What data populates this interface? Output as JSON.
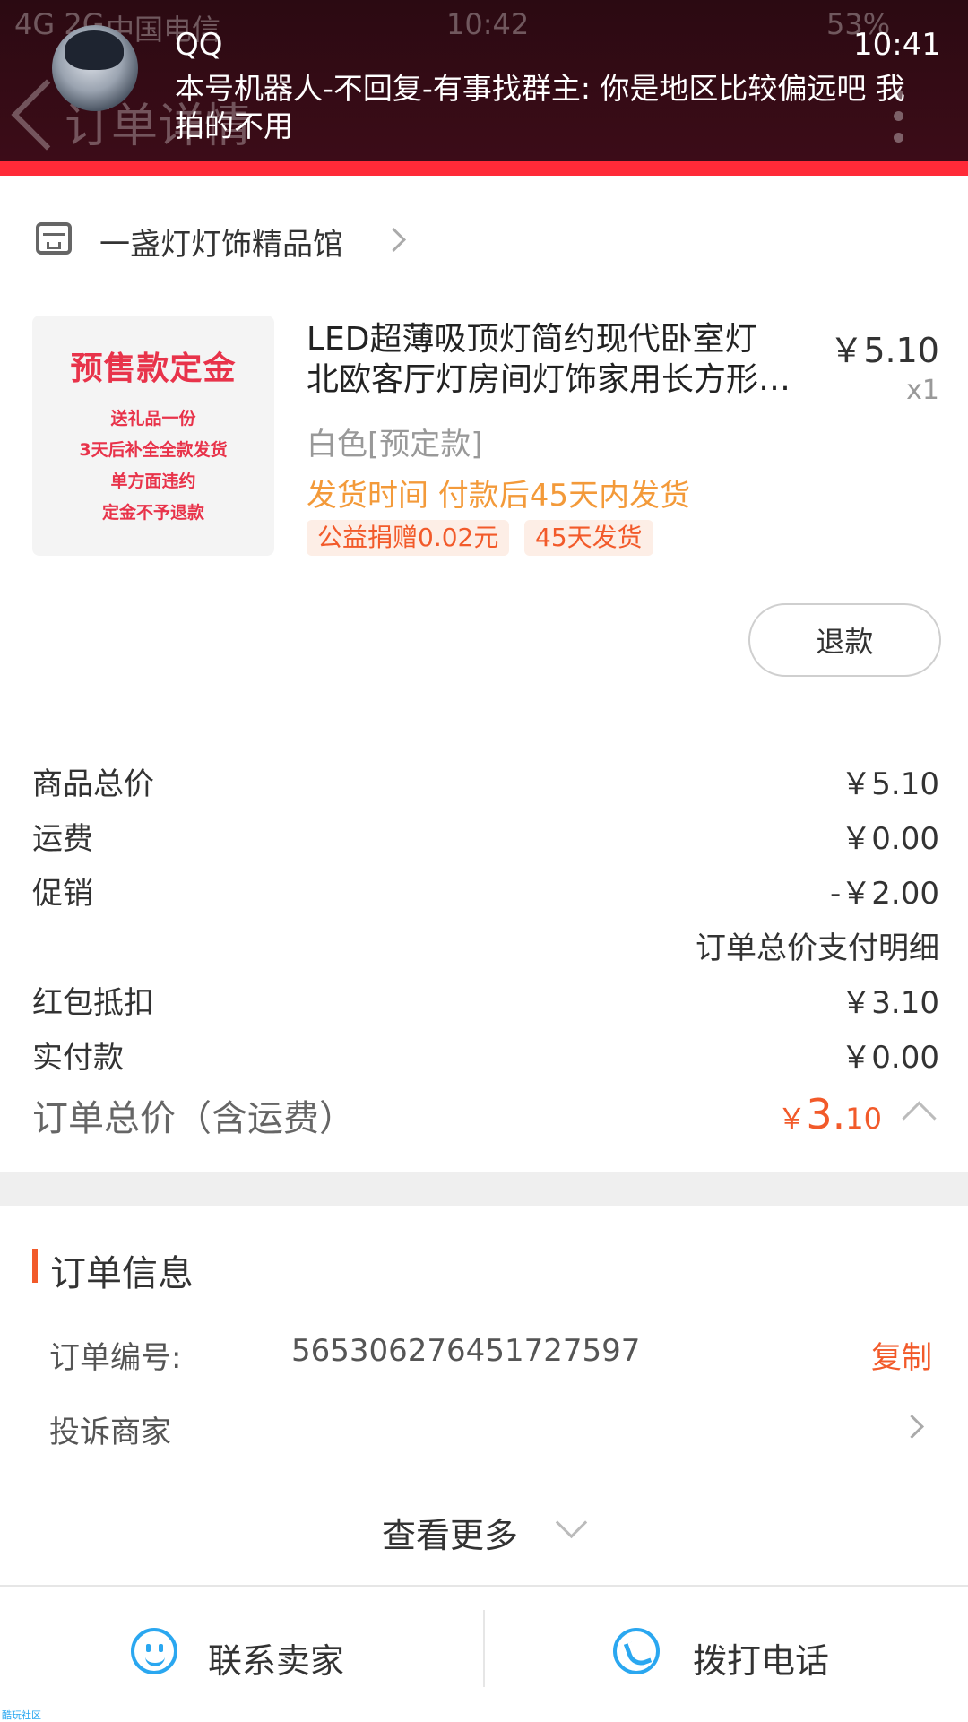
{
  "status_bar": {
    "network": "4G 2G",
    "carrier": "中国电信",
    "time": "10:42",
    "battery": "53%"
  },
  "page": {
    "title": "订单详情"
  },
  "notification": {
    "app": "QQ",
    "time": "10:41",
    "message": "本号机器人-不回复-有事找群主: 你是地区比较偏远吧 我拍的不用"
  },
  "shop": {
    "name": "一盏灯灯饰精品馆"
  },
  "product": {
    "thumbnail": {
      "title": "预售款定金",
      "lines": [
        "送礼品一份",
        "3天后补全全款发货",
        "单方面违约",
        "定金不予退款"
      ]
    },
    "title_line1": "LED超薄吸顶灯简约现代卧室灯",
    "title_line2": "北欧客厅灯房间灯饰家用长方形…",
    "price": "￥5.10",
    "quantity": "x1",
    "sku": "白色[预定款]",
    "shipping": "发货时间 付款后45天内发货",
    "tags": [
      "公益捐赠0.02元",
      "45天发货"
    ],
    "refund_label": "退款"
  },
  "pricing": {
    "rows": [
      {
        "label": "商品总价",
        "value": "￥5.10"
      },
      {
        "label": "运费",
        "value": "￥0.00"
      },
      {
        "label": "促销",
        "value": "-￥2.00"
      },
      {
        "label": "",
        "value": "订单总价支付明细"
      },
      {
        "label": "红包抵扣",
        "value": "￥3.10"
      },
      {
        "label": "实付款",
        "value": "￥0.00"
      }
    ],
    "total_label": "订单总价（含运费）",
    "total_currency": "￥",
    "total_int": "3.",
    "total_dec": "10"
  },
  "order_info": {
    "section_title": "订单信息",
    "number_label": "订单编号:",
    "number_value": "565306276451727597",
    "copy_label": "复制",
    "complain_label": "投诉商家",
    "more_label": "查看更多"
  },
  "bottom_bar": {
    "contact_label": "联系卖家",
    "call_label": "拨打电话"
  },
  "watermark": "酷玩社区",
  "colors": {
    "accent": "#f25a2a",
    "header": "#3c0c18",
    "header_line": "#ff2a38",
    "icon_blue": "#2aa7f0",
    "ship_orange": "#f39a3a"
  },
  "icons": {
    "shop": "shop-icon",
    "chat": "chat-icon",
    "phone": "phone-icon",
    "back": "back-icon",
    "more": "more-icon"
  }
}
